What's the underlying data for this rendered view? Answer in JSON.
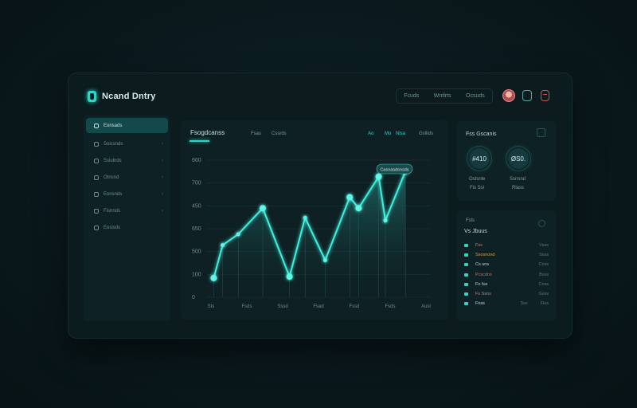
{
  "app": {
    "title": "Ncand Dntry"
  },
  "topnav": {
    "items": [
      "Fcuds",
      "Wntlrts",
      "Ocsuds"
    ]
  },
  "sidebar": {
    "items": [
      {
        "label": "Eonsads",
        "active": true
      },
      {
        "label": "Soicsnds",
        "active": false
      },
      {
        "label": "Ssiulnds",
        "active": false
      },
      {
        "label": "Otnsnd",
        "active": false
      },
      {
        "label": "Eonsnds",
        "active": false
      },
      {
        "label": "Fisnnds",
        "active": false
      },
      {
        "label": "Eosisds",
        "active": false
      }
    ]
  },
  "chart_card": {
    "title": "Fsogdcanss",
    "tabs": [
      "Fsas",
      "Cssrds"
    ],
    "tabs_right": [
      "Ao",
      "Mo",
      "Nlsa",
      "Gsllids"
    ],
    "tooltip": "Casnasdsnsds"
  },
  "chart_data": {
    "type": "area",
    "y_tick_labels": [
      "660",
      "700",
      "450",
      "650",
      "500",
      "100",
      "0"
    ],
    "x_tick_labels": [
      "Sts",
      "Fsds",
      "Sssd",
      "Fsad",
      "Fssd",
      "Fsds",
      "Ausl"
    ],
    "series": [
      {
        "values": [
          0.14,
          0.38,
          0.46,
          0.65,
          0.15,
          0.58,
          0.27,
          0.73,
          0.65,
          0.88,
          0.56,
          0.92
        ]
      }
    ],
    "x_positions": [
      0.03,
      0.07,
      0.14,
      0.25,
      0.37,
      0.44,
      0.53,
      0.64,
      0.68,
      0.77,
      0.8,
      0.89
    ],
    "ylim": [
      0,
      1
    ],
    "grid": true,
    "colors": {
      "line": "#3ff0de",
      "fill": "#1f6a68"
    }
  },
  "stats_card": {
    "title": "Fss Gscanis",
    "gauges": [
      {
        "value": "#410",
        "label": "Ostsnle",
        "sub": "Fis Ssl"
      },
      {
        "value": "ØS0.",
        "label": "Ssnsnd",
        "sub": "Rlass"
      }
    ]
  },
  "list_card": {
    "header_a": "Fsls",
    "header_b": "Vs Jbuus",
    "rows": [
      {
        "label": "Fss",
        "value": "Vsss",
        "color": "#e07a6a"
      },
      {
        "label": "Ssosnond",
        "value": "Ssss",
        "color": "#d9a441"
      },
      {
        "label": "Cs uns",
        "value": "Cnss",
        "color": "#c2dcdc"
      },
      {
        "label": "Pcscdns",
        "value": "Bsss",
        "color": "#e0684f"
      },
      {
        "label": "Fo fus",
        "value": "Cnss",
        "color": "#c2dcdc"
      },
      {
        "label": "Fs Ssns",
        "value": "Gsss",
        "color": "#e07a6a"
      },
      {
        "label": "Fnss",
        "value": "Flus",
        "color": "#c2dcdc"
      }
    ],
    "row_footer_mid": "Sss"
  },
  "colors": {
    "accent": "#2fd6c8",
    "background": "#0a191d"
  }
}
